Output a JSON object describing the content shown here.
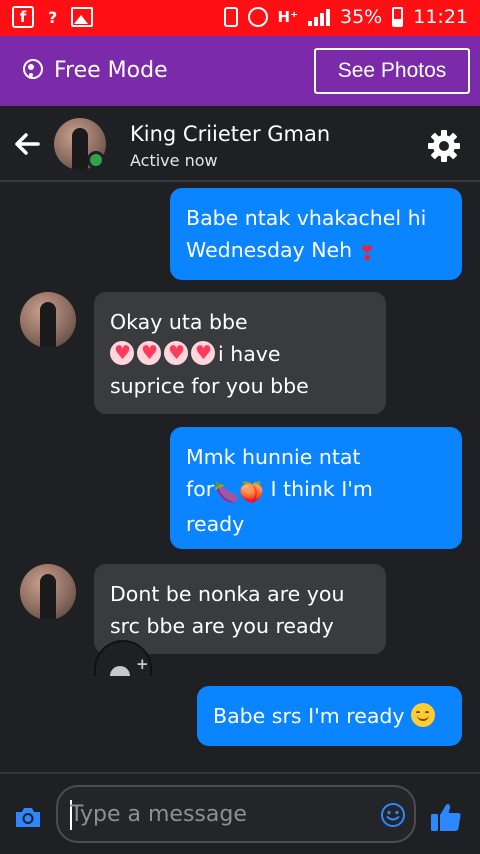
{
  "status_bar": {
    "sim_label": "?",
    "network": "H⁺",
    "battery": "35%",
    "time": "11:21"
  },
  "free_mode_bar": {
    "label": "Free Mode",
    "see_photos_label": "See Photos"
  },
  "header": {
    "contact_name": "King Criieter Gman",
    "status": "Active now"
  },
  "messages": [
    {
      "direction": "outgoing",
      "lines": [
        "Babe ntak vhakachel hi",
        "Wednesday Neh"
      ],
      "trailing_emoji": "heart-exclamation-emoji"
    },
    {
      "direction": "incoming",
      "lines": [
        "Okay uta bbe",
        "i have",
        "suprice for you bbe"
      ],
      "heart_emojis": 4
    },
    {
      "direction": "outgoing",
      "lines": [
        "Mmk hunnie ntat",
        "for",
        "I think I'm",
        "ready"
      ],
      "emojis": [
        "🍆",
        "🍑"
      ]
    },
    {
      "direction": "incoming",
      "lines": [
        "Dont be nonka are you",
        "src bbe are you ready"
      ]
    },
    {
      "direction": "outgoing",
      "lines": [
        "Babe srs I'm ready"
      ],
      "trailing_emoji": "smiling-face-emoji"
    }
  ],
  "composer": {
    "placeholder": "Type a message"
  },
  "colors": {
    "status_bar": "#ff0f13",
    "free_mode_bar": "#7b2ba9",
    "outgoing_bubble": "#0a84ff",
    "incoming_bubble": "#3a3b3f",
    "background": "#1f2023",
    "accent_blue": "#2d88ff"
  }
}
